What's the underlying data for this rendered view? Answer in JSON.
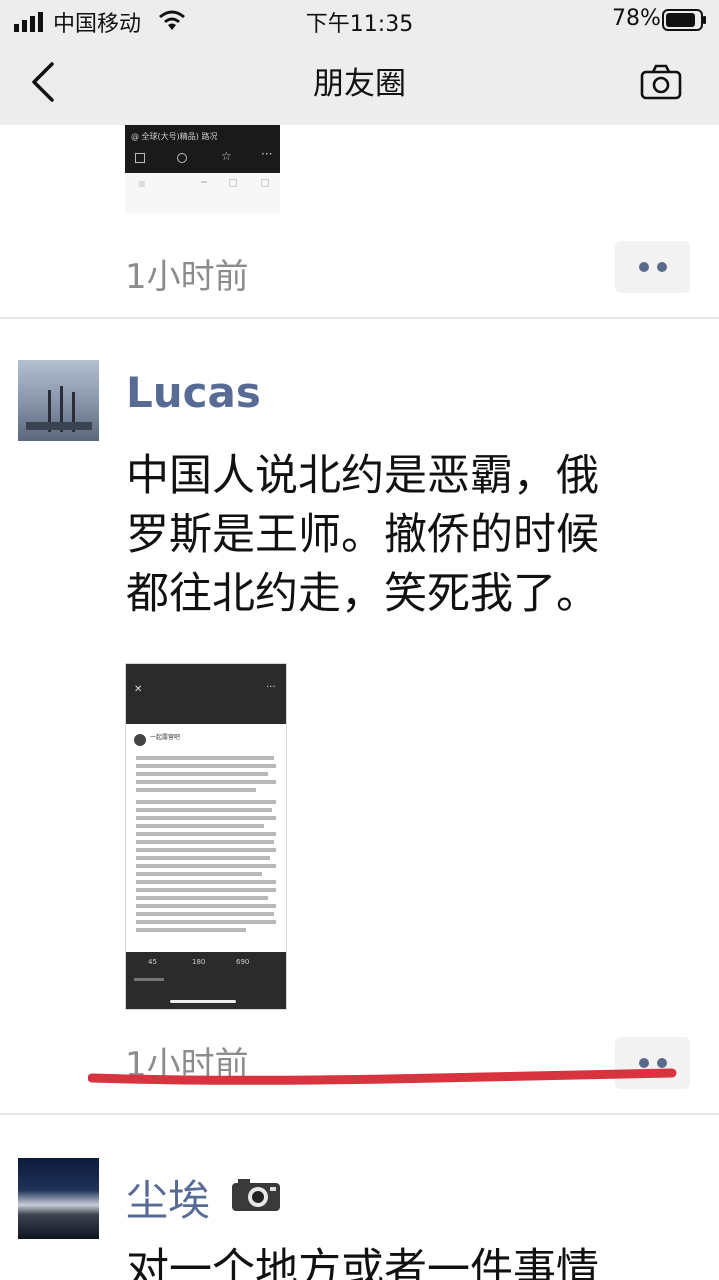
{
  "status_bar": {
    "carrier": "中国移动",
    "time": "下午11:35",
    "battery": "78%"
  },
  "nav": {
    "title": "朋友圈",
    "back_icon": "chevron-left-icon",
    "camera_icon": "camera-icon"
  },
  "posts": [
    {
      "time": "1小时前",
      "image_caption": "@ 全球(大号)精品) 路况"
    },
    {
      "author": "Lucas",
      "text_lines": [
        "中国人说北约是恶霸，俄",
        "罗斯是王师。撤侨的时候",
        "都往北约走，笑死我了。"
      ],
      "shot": {
        "profile_name": "一起露营吧",
        "stats": [
          "45",
          "180",
          "690"
        ]
      },
      "time": "1小时前"
    },
    {
      "author": "尘埃",
      "text_line": "对一个地方或者一件事情"
    }
  ],
  "colors": {
    "username": "#576b95",
    "time": "#8c8c8c",
    "underline": "#d8343f"
  }
}
